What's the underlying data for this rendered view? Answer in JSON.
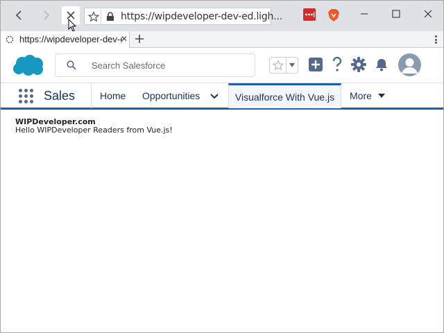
{
  "browser": {
    "url": "https://wipdeveloper-dev-ed.ligh...",
    "tab_title": "https://wipdeveloper-dev-e",
    "new_tab_symbol": "+",
    "tab_close_symbol": "✕",
    "accent": "#1b5fb0",
    "icons": [
      "back-icon",
      "forward-icon",
      "stop-icon",
      "bookmark-star-icon",
      "lock-icon",
      "lastpass-icon",
      "brave-icon",
      "minimize-icon",
      "maximize-icon",
      "close-window-icon",
      "spinner-icon",
      "menu-icon"
    ]
  },
  "salesforce": {
    "search_placeholder": "Search Salesforce",
    "app_name": "Sales",
    "nav_items": [
      "Home",
      "Opportunities",
      "Visualforce With Vue.js",
      "More"
    ],
    "active_tab": "Visualforce With Vue.js",
    "brand_color": "#1798c1",
    "icons": [
      "salesforce-cloud-icon",
      "search-icon",
      "favorites-star-icon",
      "add-icon",
      "help-icon",
      "setup-gear-icon",
      "notification-bell-icon",
      "user-avatar-icon",
      "app-launcher-icon"
    ]
  },
  "content": {
    "title": "WIPDeveloper.com",
    "message": "Hello WIPDeveloper Readers from Vue.js!"
  }
}
